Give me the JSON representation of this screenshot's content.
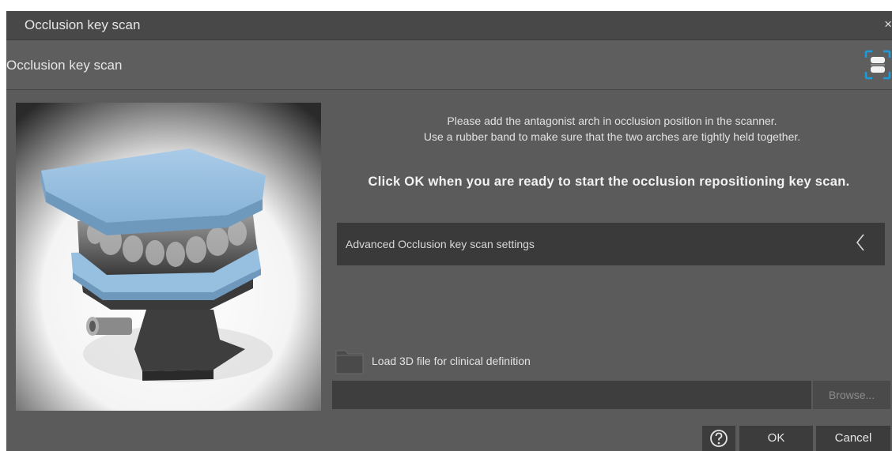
{
  "window": {
    "title": "Occlusion key scan",
    "close_glyph": "×"
  },
  "header": {
    "title": "Occlusion key scan",
    "icon": "occlusion-scan-icon"
  },
  "illustration": {
    "icon": "articulator-model-image"
  },
  "instructions": {
    "line1": "Please add the antagonist arch in occlusion position in the scanner.",
    "line2": "Use a rubber band to make sure that the two arches are tightly held together.",
    "cta": "Click OK when you are ready to start the occlusion repositioning key scan."
  },
  "advanced": {
    "label": "Advanced Occlusion key scan settings",
    "chevron": "〈"
  },
  "load": {
    "label": "Load 3D file for clinical definition",
    "icon": "folder-icon",
    "path_value": "",
    "browse_label": "Browse..."
  },
  "footer": {
    "help_icon": "help-icon",
    "ok_label": "OK",
    "cancel_label": "Cancel"
  },
  "colors": {
    "dialog_bg": "#5b5b5b",
    "titlebar_bg": "#484848",
    "dark_panel": "#3a3a3a",
    "model_blue": "#9cc4e4",
    "icon_blue": "#1a9de0"
  }
}
